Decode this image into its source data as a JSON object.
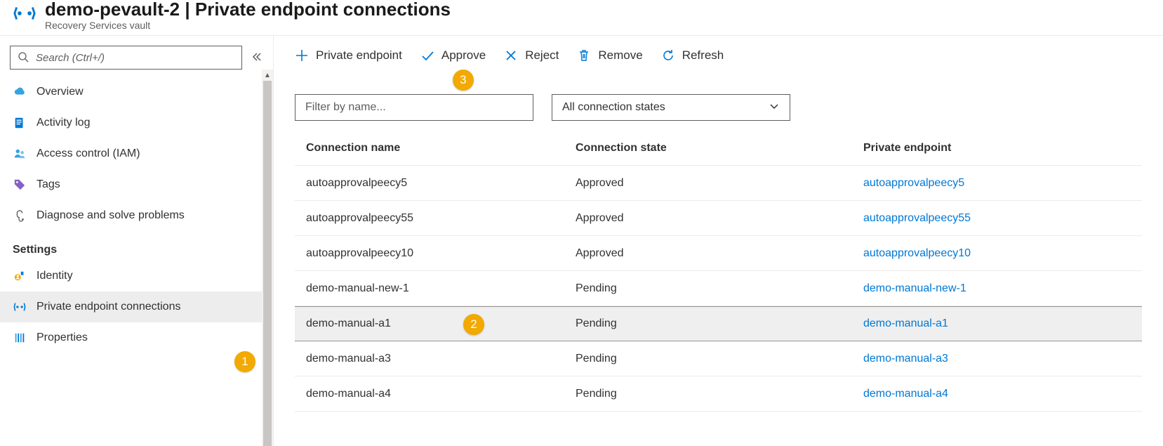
{
  "header": {
    "title": "demo-pevault-2 | Private endpoint connections",
    "subtitle": "Recovery Services vault"
  },
  "sidebar": {
    "search_placeholder": "Search (Ctrl+/)",
    "items_top": [
      {
        "icon": "cloud",
        "label": "Overview"
      },
      {
        "icon": "log",
        "label": "Activity log"
      },
      {
        "icon": "iam",
        "label": "Access control (IAM)"
      },
      {
        "icon": "tag",
        "label": "Tags"
      },
      {
        "icon": "diagnose",
        "label": "Diagnose and solve problems"
      }
    ],
    "section_label": "Settings",
    "items_settings": [
      {
        "icon": "identity",
        "label": "Identity"
      },
      {
        "icon": "pe",
        "label": "Private endpoint connections",
        "selected": true
      },
      {
        "icon": "props",
        "label": "Properties"
      }
    ]
  },
  "toolbar": {
    "private_endpoint": "Private endpoint",
    "approve": "Approve",
    "reject": "Reject",
    "remove": "Remove",
    "refresh": "Refresh"
  },
  "filters": {
    "name_placeholder": "Filter by name...",
    "state_selected": "All connection states"
  },
  "table": {
    "headers": {
      "name": "Connection name",
      "state": "Connection state",
      "pe": "Private endpoint"
    },
    "rows": [
      {
        "name": "autoapprovalpeecy5",
        "state": "Approved",
        "pe": "autoapprovalpeecy5"
      },
      {
        "name": "autoapprovalpeecy55",
        "state": "Approved",
        "pe": "autoapprovalpeecy55"
      },
      {
        "name": "autoapprovalpeecy10",
        "state": "Approved",
        "pe": "autoapprovalpeecy10"
      },
      {
        "name": "demo-manual-new-1",
        "state": "Pending",
        "pe": "demo-manual-new-1"
      },
      {
        "name": "demo-manual-a1",
        "state": "Pending",
        "pe": "demo-manual-a1",
        "selected": true
      },
      {
        "name": "demo-manual-a3",
        "state": "Pending",
        "pe": "demo-manual-a3"
      },
      {
        "name": "demo-manual-a4",
        "state": "Pending",
        "pe": "demo-manual-a4"
      }
    ]
  },
  "annotations": {
    "b1": "1",
    "b2": "2",
    "b3": "3"
  }
}
